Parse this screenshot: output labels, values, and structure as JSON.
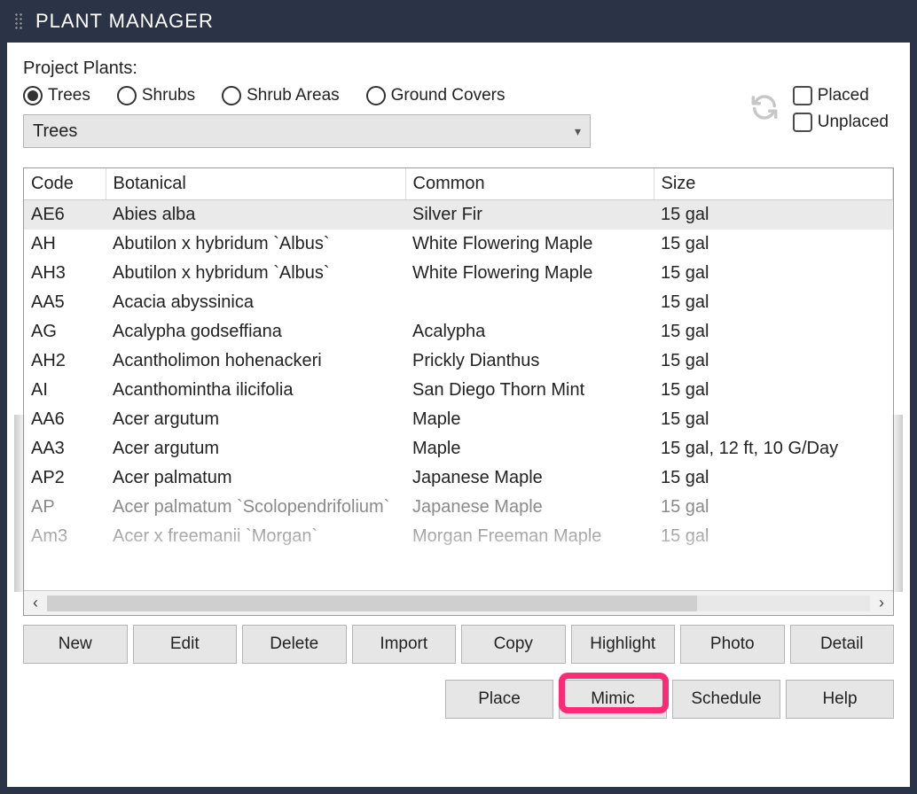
{
  "title": "PLANT MANAGER",
  "section_label": "Project Plants:",
  "radios": {
    "trees": {
      "label": "Trees",
      "selected": true
    },
    "shrubs": {
      "label": "Shrubs",
      "selected": false
    },
    "areas": {
      "label": "Shrub Areas",
      "selected": false
    },
    "ground": {
      "label": "Ground Covers",
      "selected": false
    }
  },
  "dropdown_value": "Trees",
  "filters": {
    "placed": {
      "label": "Placed",
      "checked": false
    },
    "unplaced": {
      "label": "Unplaced",
      "checked": false
    }
  },
  "columns": {
    "code": "Code",
    "bot": "Botanical",
    "common": "Common",
    "size": "Size"
  },
  "rows": [
    {
      "code": "AE6",
      "bot": "Abies alba",
      "common": "Silver Fir",
      "size": "15 gal",
      "sel": true
    },
    {
      "code": "AH",
      "bot": "Abutilon x hybridum `Albus`",
      "common": "White Flowering Maple",
      "size": "15 gal"
    },
    {
      "code": "AH3",
      "bot": "Abutilon x hybridum `Albus`",
      "common": "White Flowering Maple",
      "size": "15 gal"
    },
    {
      "code": "AA5",
      "bot": "Acacia abyssinica",
      "common": "",
      "size": "15 gal"
    },
    {
      "code": "AG",
      "bot": "Acalypha godseffiana",
      "common": "Acalypha",
      "size": "15 gal"
    },
    {
      "code": "AH2",
      "bot": "Acantholimon hohenackeri",
      "common": "Prickly Dianthus",
      "size": "15 gal"
    },
    {
      "code": "AI",
      "bot": "Acanthomintha ilicifolia",
      "common": "San Diego Thorn Mint",
      "size": "15 gal"
    },
    {
      "code": "AA6",
      "bot": "Acer argutum",
      "common": "Maple",
      "size": "15 gal"
    },
    {
      "code": "AA3",
      "bot": "Acer argutum",
      "common": "Maple",
      "size": "15 gal, 12 ft, 10 G/Day"
    },
    {
      "code": "AP2",
      "bot": "Acer palmatum",
      "common": "Japanese Maple",
      "size": "15 gal"
    },
    {
      "code": "AP",
      "bot": "Acer palmatum  `Scolopendrifolium`",
      "common": "Japanese Maple",
      "size": "15 gal",
      "faded": true
    },
    {
      "code": "Am3",
      "bot": "Acer x freemanii `Morgan`",
      "common": "Morgan Freeman Maple",
      "size": "15 gal",
      "faded": true
    }
  ],
  "buttons": {
    "new": "New",
    "edit": "Edit",
    "delete": "Delete",
    "import": "Import",
    "copy": "Copy",
    "highlight": "Highlight",
    "photo": "Photo",
    "detail": "Detail"
  },
  "buttons2": {
    "place": "Place",
    "mimic": "Mimic",
    "schedule": "Schedule",
    "help": "Help"
  }
}
